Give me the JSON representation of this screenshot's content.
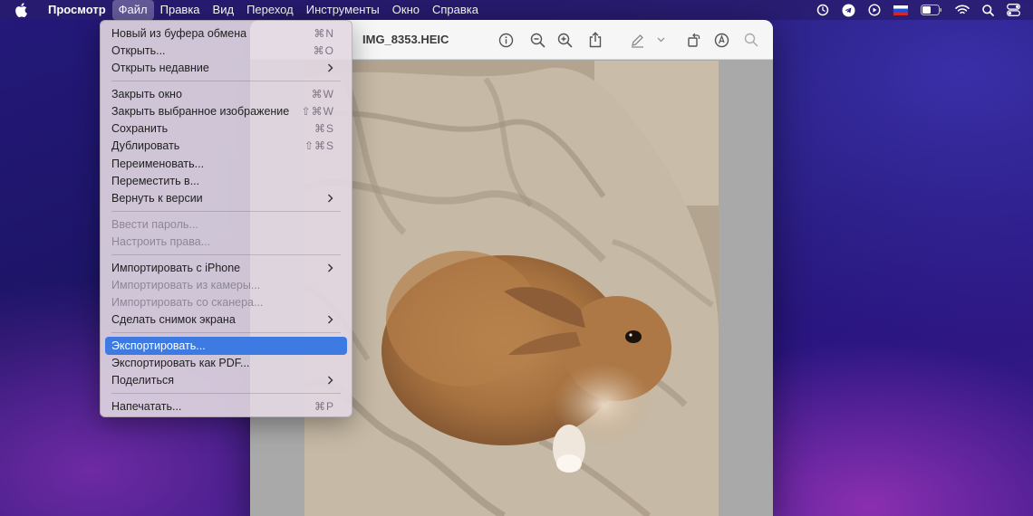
{
  "menubar": {
    "app_name": "Просмотр",
    "items": [
      "Файл",
      "Правка",
      "Вид",
      "Переход",
      "Инструменты",
      "Окно",
      "Справка"
    ],
    "active_item": "Файл",
    "status_icons": [
      "screen-time-icon",
      "telegram-icon",
      "play-icon",
      "russian-flag-icon",
      "battery-icon",
      "wifi-icon",
      "search-icon",
      "control-center-icon"
    ]
  },
  "window": {
    "filename": "IMG_8353.HEIC",
    "toolbar_icons": [
      "info-icon",
      "zoom-out-icon",
      "zoom-in-icon",
      "share-icon",
      "markup-pen-icon",
      "chevron-down-icon",
      "rotate-icon",
      "markup-circle-icon",
      "search-icon"
    ]
  },
  "file_menu": {
    "rows": [
      {
        "type": "item",
        "label": "Новый из буфера обмена",
        "shortcut": "⌘N",
        "enabled": true
      },
      {
        "type": "item",
        "label": "Открыть...",
        "shortcut": "⌘O",
        "enabled": true
      },
      {
        "type": "item",
        "label": "Открыть недавние",
        "submenu": true,
        "enabled": true
      },
      {
        "type": "separator"
      },
      {
        "type": "item",
        "label": "Закрыть окно",
        "shortcut": "⌘W",
        "enabled": true
      },
      {
        "type": "item",
        "label": "Закрыть выбранное изображение",
        "shortcut": "⇧⌘W",
        "enabled": true
      },
      {
        "type": "item",
        "label": "Сохранить",
        "shortcut": "⌘S",
        "enabled": true
      },
      {
        "type": "item",
        "label": "Дублировать",
        "shortcut": "⇧⌘S",
        "enabled": true
      },
      {
        "type": "item",
        "label": "Переименовать...",
        "enabled": true
      },
      {
        "type": "item",
        "label": "Переместить в...",
        "enabled": true
      },
      {
        "type": "item",
        "label": "Вернуть к версии",
        "submenu": true,
        "enabled": true
      },
      {
        "type": "separator"
      },
      {
        "type": "item",
        "label": "Ввести пароль...",
        "enabled": false
      },
      {
        "type": "item",
        "label": "Настроить права...",
        "enabled": false
      },
      {
        "type": "separator"
      },
      {
        "type": "item",
        "label": "Импортировать с iPhone",
        "submenu": true,
        "enabled": true
      },
      {
        "type": "item",
        "label": "Импортировать из камеры...",
        "enabled": false
      },
      {
        "type": "item",
        "label": "Импортировать со сканера...",
        "enabled": false
      },
      {
        "type": "item",
        "label": "Сделать снимок экрана",
        "submenu": true,
        "enabled": true
      },
      {
        "type": "separator"
      },
      {
        "type": "item",
        "label": "Экспортировать...",
        "enabled": true,
        "selected": true
      },
      {
        "type": "item",
        "label": "Экспортировать как PDF...",
        "enabled": true
      },
      {
        "type": "item",
        "label": "Поделиться",
        "submenu": true,
        "enabled": true
      },
      {
        "type": "separator"
      },
      {
        "type": "item",
        "label": "Напечатать...",
        "shortcut": "⌘P",
        "enabled": true
      }
    ]
  },
  "colors": {
    "selection": "#3d7be3",
    "menubar_active": "rgba(255,255,255,0.28)"
  }
}
